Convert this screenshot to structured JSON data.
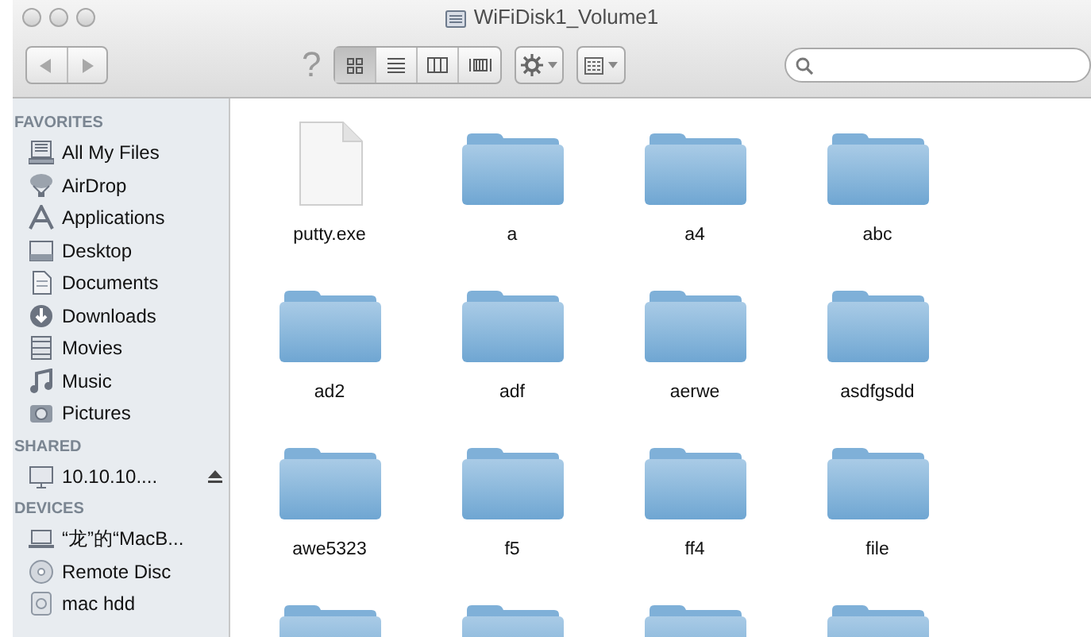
{
  "window": {
    "title": "WiFiDisk1_Volume1"
  },
  "toolbar": {
    "view_modes": [
      {
        "selected": true
      },
      {
        "selected": false
      },
      {
        "selected": false
      },
      {
        "selected": false
      }
    ],
    "help": "?"
  },
  "sidebar": [
    {
      "heading": "FAVORITES",
      "items": [
        {
          "label": "All My Files"
        },
        {
          "label": "AirDrop"
        },
        {
          "label": "Applications"
        },
        {
          "label": "Desktop"
        },
        {
          "label": "Documents"
        },
        {
          "label": "Downloads"
        },
        {
          "label": "Movies"
        },
        {
          "label": "Music"
        },
        {
          "label": "Pictures"
        }
      ]
    },
    {
      "heading": "SHARED",
      "items": [
        {
          "label": "10.10.10....",
          "ejectable": true
        }
      ]
    },
    {
      "heading": "DEVICES",
      "items": [
        {
          "label": "“龙”的“MacB..."
        },
        {
          "label": "Remote Disc"
        },
        {
          "label": "mac hdd"
        }
      ]
    }
  ],
  "files": [
    {
      "kind": "document",
      "name": "putty.exe"
    },
    {
      "kind": "folder",
      "name": "a"
    },
    {
      "kind": "folder",
      "name": "a4"
    },
    {
      "kind": "folder",
      "name": "abc"
    },
    {
      "kind": "folder",
      "name": "ad2"
    },
    {
      "kind": "folder",
      "name": "adf"
    },
    {
      "kind": "folder",
      "name": "aerwe"
    },
    {
      "kind": "folder",
      "name": "asdfgsdd"
    },
    {
      "kind": "folder",
      "name": "awe5323"
    },
    {
      "kind": "folder",
      "name": "f5"
    },
    {
      "kind": "folder",
      "name": "ff4"
    },
    {
      "kind": "folder",
      "name": "file"
    },
    {
      "kind": "folder"
    },
    {
      "kind": "folder"
    },
    {
      "kind": "folder"
    },
    {
      "kind": "folder"
    }
  ]
}
